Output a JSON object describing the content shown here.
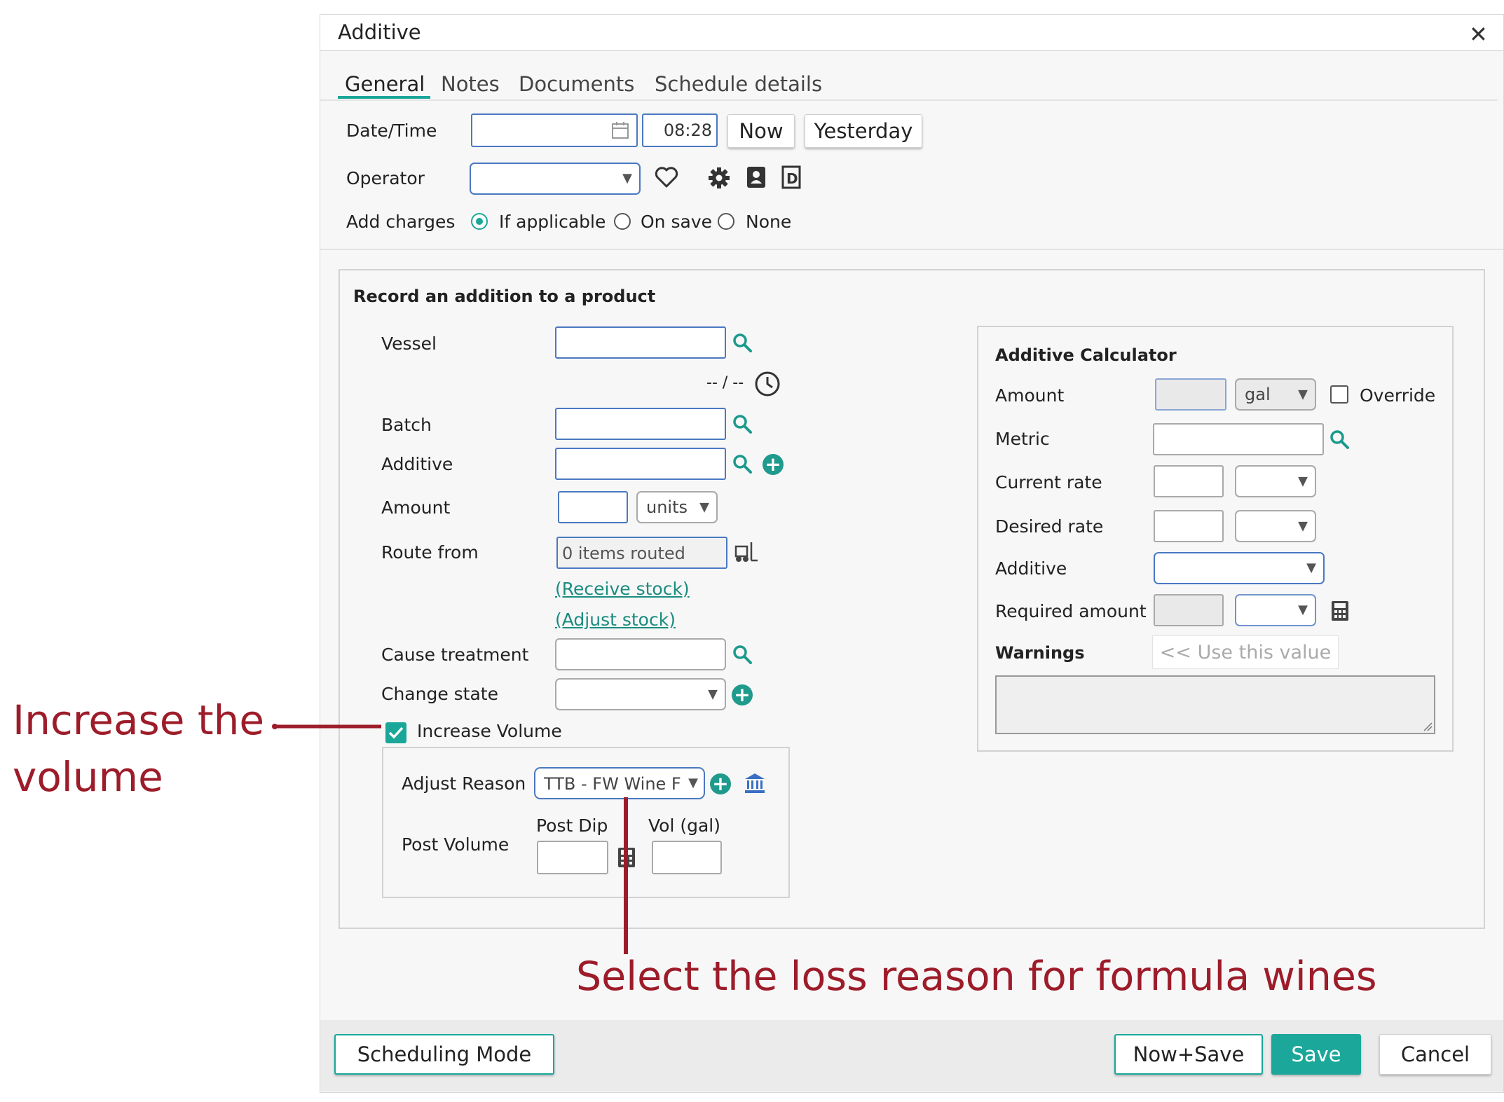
{
  "dialog": {
    "title": "Additive"
  },
  "tabs": [
    {
      "label": "General",
      "active": true
    },
    {
      "label": "Notes"
    },
    {
      "label": "Documents"
    },
    {
      "label": "Schedule details"
    }
  ],
  "header_form": {
    "datetime_label": "Date/Time",
    "time_value": "08:28",
    "now_button": "Now",
    "yesterday_button": "Yesterday",
    "operator_label": "Operator",
    "add_charges_label": "Add charges",
    "charges_options": [
      "If applicable",
      "On save",
      "None"
    ],
    "charges_selected": "If applicable"
  },
  "record": {
    "heading": "Record an addition to a product",
    "vessel_label": "Vessel",
    "vessel_time": "-- / --",
    "batch_label": "Batch",
    "additive_label": "Additive",
    "amount_label": "Amount",
    "amount_unit": "units",
    "route_label": "Route from",
    "route_value": "0 items routed",
    "receive_stock_link": "(Receive stock)",
    "adjust_stock_link": "(Adjust stock)",
    "cause_label": "Cause treatment",
    "change_state_label": "Change state",
    "increase_volume_label": "Increase Volume",
    "increase_volume_checked": true,
    "adjust_reason_label": "Adjust Reason",
    "adjust_reason_value": "TTB - FW Wine F",
    "post_volume_label": "Post Volume",
    "post_dip_label": "Post Dip",
    "vol_label": "Vol (gal)"
  },
  "calculator": {
    "heading": "Additive Calculator",
    "amount_label": "Amount",
    "amount_unit": "gal",
    "override_label": "Override",
    "metric_label": "Metric",
    "current_rate_label": "Current rate",
    "desired_rate_label": "Desired rate",
    "additive_label": "Additive",
    "required_amount_label": "Required amount",
    "warnings_label": "Warnings",
    "use_value_button": "<< Use this value"
  },
  "footer": {
    "scheduling_button": "Scheduling Mode",
    "now_save_button": "Now+Save",
    "save_button": "Save",
    "cancel_button": "Cancel"
  },
  "annotations": {
    "increase_line1": "Increase the",
    "increase_line2": "volume",
    "select_reason": "Select the loss reason for formula wines"
  },
  "colors": {
    "accent": "#1aa79a",
    "save_bg": "#1ba79a",
    "annotation": "#9d1c2a",
    "field_border": "#4a78c2"
  }
}
